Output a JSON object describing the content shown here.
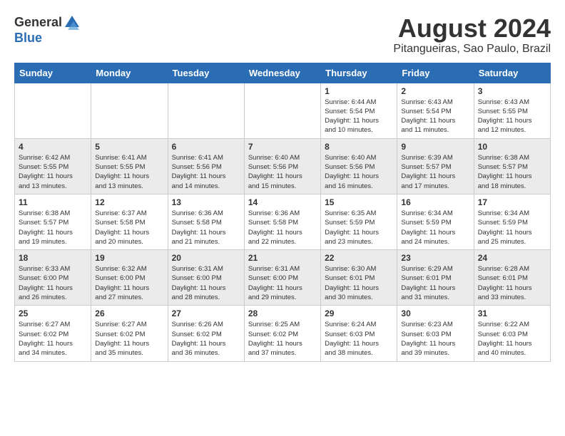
{
  "header": {
    "logo_general": "General",
    "logo_blue": "Blue",
    "month_title": "August 2024",
    "location": "Pitangueiras, Sao Paulo, Brazil"
  },
  "weekdays": [
    "Sunday",
    "Monday",
    "Tuesday",
    "Wednesday",
    "Thursday",
    "Friday",
    "Saturday"
  ],
  "rows": [
    [
      {
        "day": "",
        "info": ""
      },
      {
        "day": "",
        "info": ""
      },
      {
        "day": "",
        "info": ""
      },
      {
        "day": "",
        "info": ""
      },
      {
        "day": "1",
        "info": "Sunrise: 6:44 AM\nSunset: 5:54 PM\nDaylight: 11 hours\nand 10 minutes."
      },
      {
        "day": "2",
        "info": "Sunrise: 6:43 AM\nSunset: 5:54 PM\nDaylight: 11 hours\nand 11 minutes."
      },
      {
        "day": "3",
        "info": "Sunrise: 6:43 AM\nSunset: 5:55 PM\nDaylight: 11 hours\nand 12 minutes."
      }
    ],
    [
      {
        "day": "4",
        "info": "Sunrise: 6:42 AM\nSunset: 5:55 PM\nDaylight: 11 hours\nand 13 minutes."
      },
      {
        "day": "5",
        "info": "Sunrise: 6:41 AM\nSunset: 5:55 PM\nDaylight: 11 hours\nand 13 minutes."
      },
      {
        "day": "6",
        "info": "Sunrise: 6:41 AM\nSunset: 5:56 PM\nDaylight: 11 hours\nand 14 minutes."
      },
      {
        "day": "7",
        "info": "Sunrise: 6:40 AM\nSunset: 5:56 PM\nDaylight: 11 hours\nand 15 minutes."
      },
      {
        "day": "8",
        "info": "Sunrise: 6:40 AM\nSunset: 5:56 PM\nDaylight: 11 hours\nand 16 minutes."
      },
      {
        "day": "9",
        "info": "Sunrise: 6:39 AM\nSunset: 5:57 PM\nDaylight: 11 hours\nand 17 minutes."
      },
      {
        "day": "10",
        "info": "Sunrise: 6:38 AM\nSunset: 5:57 PM\nDaylight: 11 hours\nand 18 minutes."
      }
    ],
    [
      {
        "day": "11",
        "info": "Sunrise: 6:38 AM\nSunset: 5:57 PM\nDaylight: 11 hours\nand 19 minutes."
      },
      {
        "day": "12",
        "info": "Sunrise: 6:37 AM\nSunset: 5:58 PM\nDaylight: 11 hours\nand 20 minutes."
      },
      {
        "day": "13",
        "info": "Sunrise: 6:36 AM\nSunset: 5:58 PM\nDaylight: 11 hours\nand 21 minutes."
      },
      {
        "day": "14",
        "info": "Sunrise: 6:36 AM\nSunset: 5:58 PM\nDaylight: 11 hours\nand 22 minutes."
      },
      {
        "day": "15",
        "info": "Sunrise: 6:35 AM\nSunset: 5:59 PM\nDaylight: 11 hours\nand 23 minutes."
      },
      {
        "day": "16",
        "info": "Sunrise: 6:34 AM\nSunset: 5:59 PM\nDaylight: 11 hours\nand 24 minutes."
      },
      {
        "day": "17",
        "info": "Sunrise: 6:34 AM\nSunset: 5:59 PM\nDaylight: 11 hours\nand 25 minutes."
      }
    ],
    [
      {
        "day": "18",
        "info": "Sunrise: 6:33 AM\nSunset: 6:00 PM\nDaylight: 11 hours\nand 26 minutes."
      },
      {
        "day": "19",
        "info": "Sunrise: 6:32 AM\nSunset: 6:00 PM\nDaylight: 11 hours\nand 27 minutes."
      },
      {
        "day": "20",
        "info": "Sunrise: 6:31 AM\nSunset: 6:00 PM\nDaylight: 11 hours\nand 28 minutes."
      },
      {
        "day": "21",
        "info": "Sunrise: 6:31 AM\nSunset: 6:00 PM\nDaylight: 11 hours\nand 29 minutes."
      },
      {
        "day": "22",
        "info": "Sunrise: 6:30 AM\nSunset: 6:01 PM\nDaylight: 11 hours\nand 30 minutes."
      },
      {
        "day": "23",
        "info": "Sunrise: 6:29 AM\nSunset: 6:01 PM\nDaylight: 11 hours\nand 31 minutes."
      },
      {
        "day": "24",
        "info": "Sunrise: 6:28 AM\nSunset: 6:01 PM\nDaylight: 11 hours\nand 33 minutes."
      }
    ],
    [
      {
        "day": "25",
        "info": "Sunrise: 6:27 AM\nSunset: 6:02 PM\nDaylight: 11 hours\nand 34 minutes."
      },
      {
        "day": "26",
        "info": "Sunrise: 6:27 AM\nSunset: 6:02 PM\nDaylight: 11 hours\nand 35 minutes."
      },
      {
        "day": "27",
        "info": "Sunrise: 6:26 AM\nSunset: 6:02 PM\nDaylight: 11 hours\nand 36 minutes."
      },
      {
        "day": "28",
        "info": "Sunrise: 6:25 AM\nSunset: 6:02 PM\nDaylight: 11 hours\nand 37 minutes."
      },
      {
        "day": "29",
        "info": "Sunrise: 6:24 AM\nSunset: 6:03 PM\nDaylight: 11 hours\nand 38 minutes."
      },
      {
        "day": "30",
        "info": "Sunrise: 6:23 AM\nSunset: 6:03 PM\nDaylight: 11 hours\nand 39 minutes."
      },
      {
        "day": "31",
        "info": "Sunrise: 6:22 AM\nSunset: 6:03 PM\nDaylight: 11 hours\nand 40 minutes."
      }
    ]
  ]
}
